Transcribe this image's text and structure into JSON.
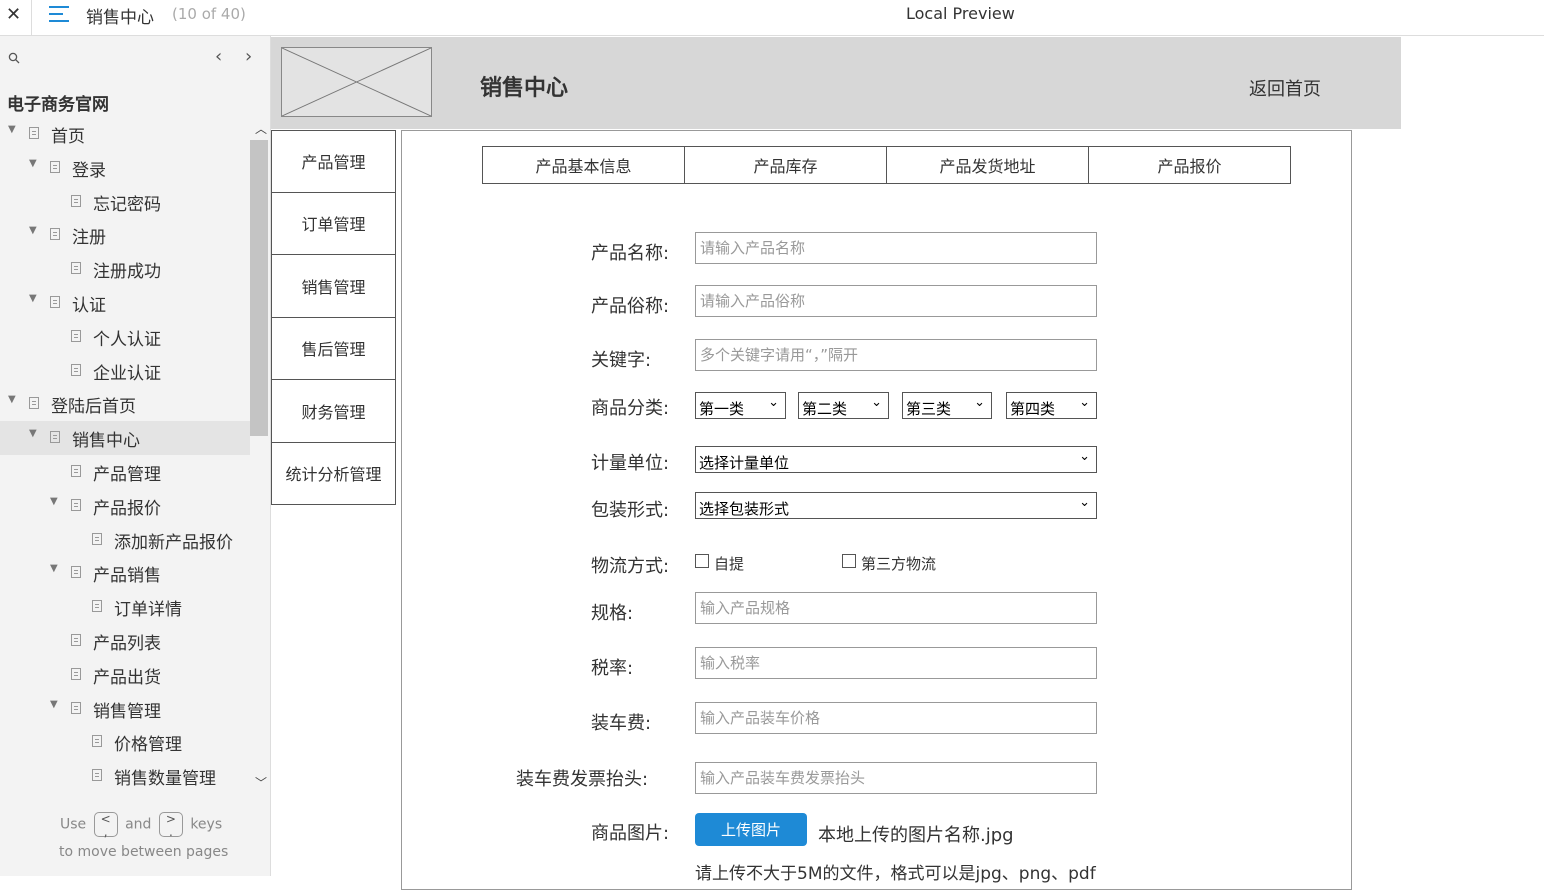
{
  "topbar": {
    "close_icon": "✕",
    "title": "销售中心",
    "page_count": "(10 of 40)",
    "preview_label": "Local Preview"
  },
  "sidebar": {
    "site_title": "电子商务官网",
    "nav_prev": "‹",
    "nav_next": "›",
    "tree": [
      {
        "label": "首页",
        "level": 0,
        "expanded": true
      },
      {
        "label": "登录",
        "level": 1,
        "expanded": true
      },
      {
        "label": "忘记密码",
        "level": 2
      },
      {
        "label": "注册",
        "level": 1,
        "expanded": true
      },
      {
        "label": "注册成功",
        "level": 2
      },
      {
        "label": "认证",
        "level": 1,
        "expanded": true
      },
      {
        "label": "个人认证",
        "level": 2
      },
      {
        "label": "企业认证",
        "level": 2
      },
      {
        "label": "登陆后首页",
        "level": 0,
        "expanded": true
      },
      {
        "label": "销售中心",
        "level": 1,
        "expanded": true,
        "selected": true
      },
      {
        "label": "产品管理",
        "level": 2
      },
      {
        "label": "产品报价",
        "level": 2,
        "expanded": true
      },
      {
        "label": "添加新产品报价",
        "level": 3
      },
      {
        "label": "产品销售",
        "level": 2,
        "expanded": true
      },
      {
        "label": "订单详情",
        "level": 3
      },
      {
        "label": "产品列表",
        "level": 2
      },
      {
        "label": "产品出货",
        "level": 2
      },
      {
        "label": "销售管理",
        "level": 2,
        "expanded": true
      },
      {
        "label": "价格管理",
        "level": 3
      },
      {
        "label": "销售数量管理",
        "level": 3
      }
    ],
    "hint_use": "Use",
    "hint_key1": "<\n,",
    "hint_and": "and",
    "hint_key2": ">\n.",
    "hint_keys": "keys",
    "hint_line2": "to move between pages"
  },
  "header": {
    "title": "销售中心",
    "home_link": "返回首页"
  },
  "left_menu": [
    "产品管理",
    "订单管理",
    "销售管理",
    "售后管理",
    "财务管理",
    "统计分析管理"
  ],
  "tabs": [
    "产品基本信息",
    "产品库存",
    "产品发货地址",
    "产品报价"
  ],
  "form": {
    "product_name_label": "产品名称:",
    "product_name_placeholder": "请输入产品名称",
    "common_name_label": "产品俗称:",
    "common_name_placeholder": "请输入产品俗称",
    "keywords_label": "关键字:",
    "keywords_placeholder": "多个关键字请用“，”隔开",
    "category_label": "商品分类:",
    "category_selects": [
      "第一类",
      "第二类",
      "第三类",
      "第四类"
    ],
    "unit_label": "计量单位:",
    "unit_select": "选择计量单位",
    "package_label": "包装形式:",
    "package_select": "选择包装形式",
    "logistics_label": "物流方式:",
    "logistics_opt1": "自提",
    "logistics_opt2": "第三方物流",
    "spec_label": "规格:",
    "spec_placeholder": "输入产品规格",
    "tax_label": "税率:",
    "tax_placeholder": "输入税率",
    "loading_fee_label": "装车费:",
    "loading_fee_placeholder": "输入产品装车价格",
    "invoice_label": "装车费发票抬头:",
    "invoice_placeholder": "输入产品装车费发票抬头",
    "image_label": "商品图片:",
    "upload_button": "上传图片",
    "upload_filename": "本地上传的图片名称.jpg",
    "upload_note": "请上传不大于5M的文件，格式可以是jpg、png、pdf"
  },
  "colors": {
    "accent": "#1e8ad6",
    "header_bg": "#d7d7d7",
    "sidebar_bg": "#f3f3f3"
  }
}
